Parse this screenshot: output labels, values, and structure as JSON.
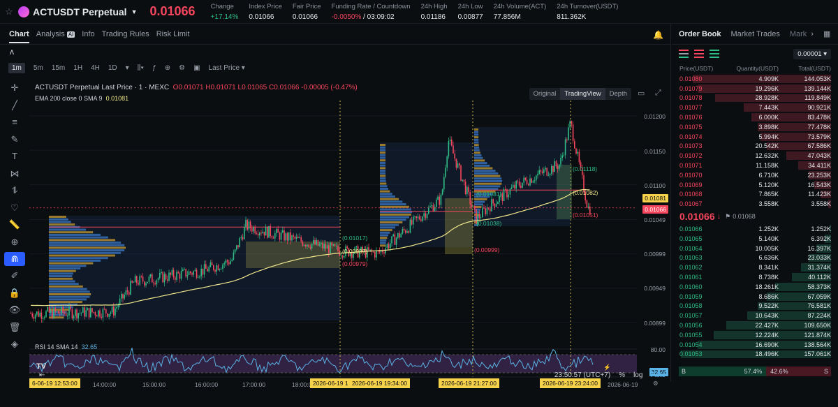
{
  "header": {
    "symbol": "ACTUSDT Perpetual",
    "last_price": "0.01066",
    "stats": [
      {
        "label": "Change",
        "value": "+17.14%",
        "tone": "green"
      },
      {
        "label": "Index Price",
        "value": "0.01066",
        "tone": ""
      },
      {
        "label": "Fair Price",
        "value": "0.01066",
        "tone": ""
      },
      {
        "label": "Funding Rate / Countdown",
        "value": "-0.0050%",
        "value2": "/ 03:09:02",
        "tone": "red"
      },
      {
        "label": "24h High",
        "value": "0.01186",
        "tone": ""
      },
      {
        "label": "24h Low",
        "value": "0.00877",
        "tone": ""
      },
      {
        "label": "24h Volume(ACT)",
        "value": "77.856M",
        "tone": ""
      },
      {
        "label": "24h Turnover(USDT)",
        "value": "811.362K",
        "tone": ""
      }
    ]
  },
  "chart_tabs": [
    "Chart",
    "Analysis",
    "Info",
    "Trading Rules",
    "Risk Limit"
  ],
  "analysis_badge": "AI",
  "brand_glyph": "ʌ",
  "toolbar": {
    "intervals": [
      "1m",
      "5m",
      "15m",
      "1H",
      "4H",
      "1D"
    ],
    "price_type": "Last Price",
    "views": [
      "Original",
      "TradingView",
      "Depth"
    ],
    "active_view": "TradingView"
  },
  "legend": {
    "title": "ACTUSDT Perpetual Last Price · 1 · MEXC",
    "ohlc": "O0.01071 H0.01071 L0.01065 C0.01066 -0.00005 (-0.47%)",
    "ema_label": "EMA 200 close 0 SMA 9",
    "ema_value": "0.01081",
    "rsi_label": "RSI 14 SMA 14",
    "rsi_value": "32.65"
  },
  "price_axis": [
    "0.01200",
    "0.01150",
    "0.01100",
    "0.01049",
    "0.00999",
    "0.00949",
    "0.00899"
  ],
  "price_tags": {
    "ema": "0.01081",
    "last": "0.01066",
    "rsi": "32.65",
    "rsi_level": "80.00"
  },
  "time_axis": [
    "14:00:00",
    "15:00:00",
    "16:00:00",
    "17:00:00",
    "18:00:00",
    "2026-06-19"
  ],
  "time_highlights": [
    "6-06-19  12:53:00",
    "2026-06-19  1",
    "2026-06-19  19:34:00",
    "2026-06-19  21:27:00",
    "2026-06-19  23:24:00"
  ],
  "vp_labels": [
    {
      "text": "(0.01017)",
      "tone": "green"
    },
    {
      "text": "(0.00997)",
      "tone": "yellow"
    },
    {
      "text": "(0.00979)",
      "tone": "red"
    },
    {
      "text": "(0.01081)",
      "tone": "green"
    },
    {
      "text": "(0.01038)",
      "tone": "green"
    },
    {
      "text": "(0.00999)",
      "tone": "red"
    },
    {
      "text": "(0.01118)",
      "tone": "green"
    },
    {
      "text": "(0.01082)",
      "tone": "yellow"
    },
    {
      "text": "(0.01051)",
      "tone": "red"
    }
  ],
  "bottom_bar": {
    "clock": "23:50:57 (UTC+7)",
    "pct": "%",
    "log": "log",
    "auto": "Auto"
  },
  "colors": {
    "up": "#2ebd85",
    "down": "#f6465d",
    "ema": "#f0e68c",
    "rsi": "#5ab4e6",
    "accent": "#2b5cff"
  },
  "orderbook": {
    "tabs": [
      "Order Book",
      "Market Trades",
      "Mark"
    ],
    "precision": "0.00001",
    "headers": [
      "Price(USDT)",
      "Quantity(USDT)",
      "Total(USDT)"
    ],
    "asks": [
      {
        "price": "0.01080",
        "qty": "4.909K",
        "total": "144.053K",
        "depth": 0.92
      },
      {
        "price": "0.01079",
        "qty": "19.296K",
        "total": "139.144K",
        "depth": 0.89
      },
      {
        "price": "0.01078",
        "qty": "28.928K",
        "total": "119.849K",
        "depth": 0.77
      },
      {
        "price": "0.01077",
        "qty": "7.443K",
        "total": "90.921K",
        "depth": 0.58
      },
      {
        "price": "0.01076",
        "qty": "6.000K",
        "total": "83.478K",
        "depth": 0.53
      },
      {
        "price": "0.01075",
        "qty": "3.898K",
        "total": "77.478K",
        "depth": 0.49
      },
      {
        "price": "0.01074",
        "qty": "5.994K",
        "total": "73.579K",
        "depth": 0.47
      },
      {
        "price": "0.01073",
        "qty": "20.542K",
        "total": "67.586K",
        "depth": 0.43
      },
      {
        "price": "0.01072",
        "qty": "12.632K",
        "total": "47.043K",
        "depth": 0.3
      },
      {
        "price": "0.01071",
        "qty": "11.158K",
        "total": "34.411K",
        "depth": 0.22
      },
      {
        "price": "0.01070",
        "qty": "6.710K",
        "total": "23.253K",
        "depth": 0.15
      },
      {
        "price": "0.01069",
        "qty": "5.120K",
        "total": "16.543K",
        "depth": 0.11
      },
      {
        "price": "0.01068",
        "qty": "7.865K",
        "total": "11.423K",
        "depth": 0.07
      },
      {
        "price": "0.01067",
        "qty": "3.558K",
        "total": "3.558K",
        "depth": 0.02
      }
    ],
    "mid_price": "0.01066",
    "mid_arrow": "↓",
    "mark_price": "0.01068",
    "bids": [
      {
        "price": "0.01066",
        "qty": "1.252K",
        "total": "1.252K",
        "depth": 0.01
      },
      {
        "price": "0.01065",
        "qty": "5.140K",
        "total": "6.392K",
        "depth": 0.04
      },
      {
        "price": "0.01064",
        "qty": "10.005K",
        "total": "16.397K",
        "depth": 0.1
      },
      {
        "price": "0.01063",
        "qty": "6.636K",
        "total": "23.033K",
        "depth": 0.15
      },
      {
        "price": "0.01062",
        "qty": "8.341K",
        "total": "31.374K",
        "depth": 0.2
      },
      {
        "price": "0.01061",
        "qty": "8.738K",
        "total": "40.112K",
        "depth": 0.26
      },
      {
        "price": "0.01060",
        "qty": "18.261K",
        "total": "58.373K",
        "depth": 0.37
      },
      {
        "price": "0.01059",
        "qty": "8.686K",
        "total": "67.059K",
        "depth": 0.43
      },
      {
        "price": "0.01058",
        "qty": "9.522K",
        "total": "76.581K",
        "depth": 0.49
      },
      {
        "price": "0.01057",
        "qty": "10.643K",
        "total": "87.224K",
        "depth": 0.56
      },
      {
        "price": "0.01056",
        "qty": "22.427K",
        "total": "109.650K",
        "depth": 0.7
      },
      {
        "price": "0.01055",
        "qty": "12.224K",
        "total": "121.874K",
        "depth": 0.78
      },
      {
        "price": "0.01054",
        "qty": "16.690K",
        "total": "138.564K",
        "depth": 0.89
      },
      {
        "price": "0.01053",
        "qty": "18.496K",
        "total": "157.061K",
        "depth": 1.0
      }
    ],
    "buy_label": "B",
    "buy_pct": "57.4%",
    "buy_ratio": 0.574,
    "sell_pct": "42.6%",
    "sell_label": "S"
  }
}
